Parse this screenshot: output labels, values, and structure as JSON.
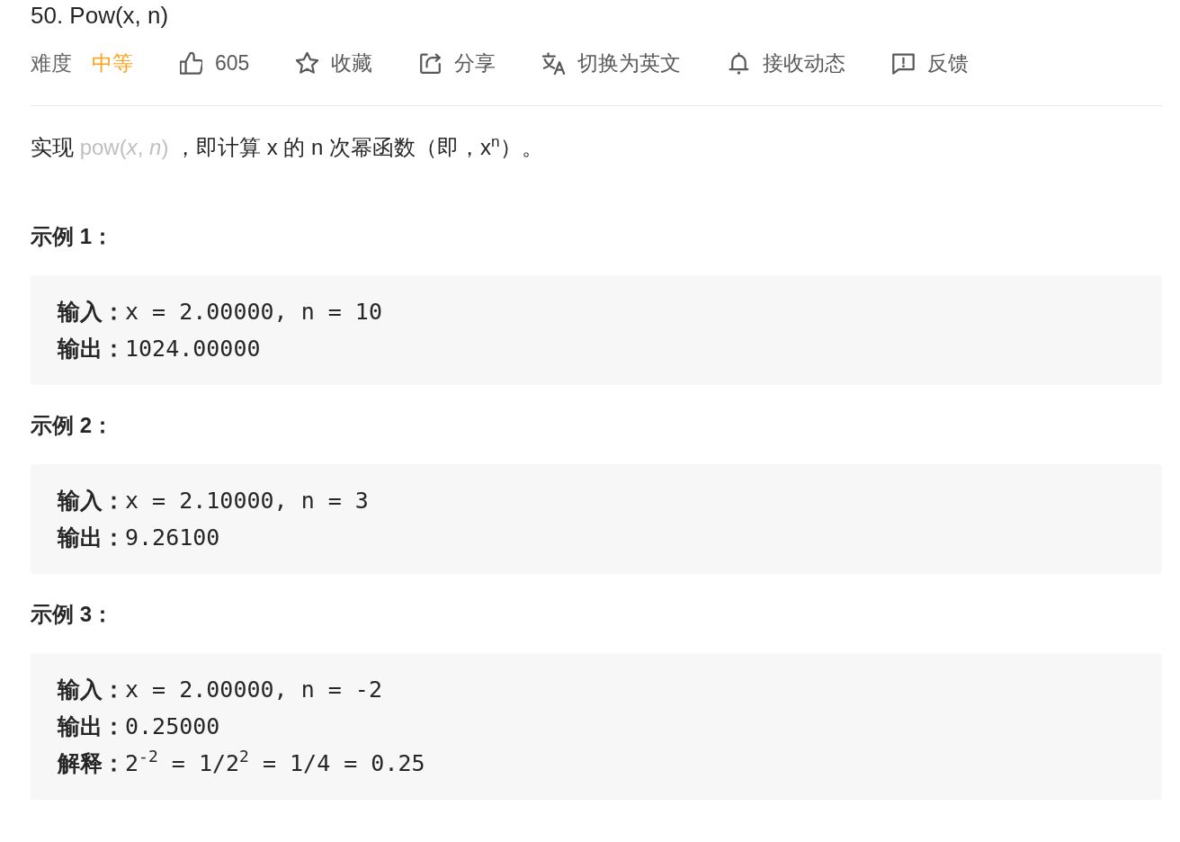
{
  "title": "50. Pow(x, n)",
  "difficulty": {
    "label": "难度",
    "value": "中等",
    "color": "#ffa116"
  },
  "actions": [
    {
      "kind": "like",
      "label": "605"
    },
    {
      "kind": "favorite",
      "label": "收藏"
    },
    {
      "kind": "share",
      "label": "分享"
    },
    {
      "kind": "translate",
      "label": "切换为英文"
    },
    {
      "kind": "subscribe",
      "label": "接收动态"
    },
    {
      "kind": "feedback",
      "label": "反馈"
    }
  ],
  "description": {
    "lead": "实现 ",
    "code": "pow(*x*, *n*)",
    "rest": " ，即计算 x 的 n 次幂函数（即，x$^{n}$）。"
  },
  "examples": [
    {
      "heading": "示例 1：",
      "lines": [
        "**输入：**x = 2.00000, n = 10",
        "**输出：**1024.00000"
      ]
    },
    {
      "heading": "示例 2：",
      "lines": [
        "**输入：**x = 2.10000, n = 3",
        "**输出：**9.26100"
      ]
    },
    {
      "heading": "示例 3：",
      "lines": [
        "**输入：**x = 2.00000, n = -2",
        "**输出：**0.25000",
        "**解释：**2$^{-2}$ = 1/2$^{2}$ = 1/4 = 0.25"
      ]
    }
  ]
}
